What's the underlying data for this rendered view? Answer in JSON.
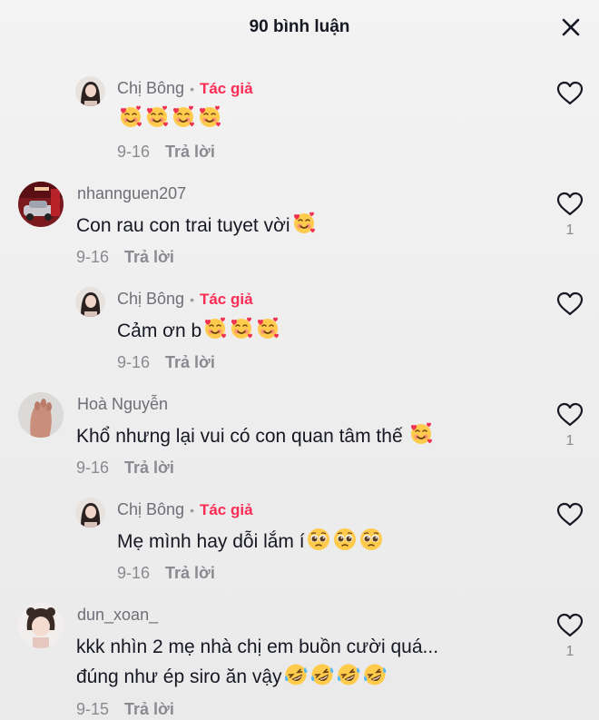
{
  "header": {
    "title": "90 bình luận"
  },
  "comments": [
    {
      "user": "Chị Bông",
      "badge": "Tác giả",
      "text": "",
      "emojis": 4,
      "emoji_type": "smiling-hearts",
      "date": "9-16",
      "reply": "Trả lời",
      "likes": ""
    },
    {
      "user": "nhannguen207",
      "badge": "",
      "text": "Con rau con trai tuyet vời",
      "emojis": 1,
      "emoji_type": "smiling-hearts",
      "date": "9-16",
      "reply": "Trả lời",
      "likes": "1"
    },
    {
      "user": "Chị Bông",
      "badge": "Tác giả",
      "text": "Cảm ơn b",
      "emojis": 3,
      "emoji_type": "smiling-hearts",
      "date": "9-16",
      "reply": "Trả lời",
      "likes": ""
    },
    {
      "user": "Hoà Nguyễn",
      "badge": "",
      "text": "Khổ nhưng lại vui có con quan tâm thế ",
      "emojis": 1,
      "emoji_type": "smiling-hearts",
      "date": "9-16",
      "reply": "Trả lời",
      "likes": "1"
    },
    {
      "user": "Chị Bông",
      "badge": "Tác giả",
      "text": "Mẹ mình hay dỗi lắm í",
      "emojis": 3,
      "emoji_type": "pleading",
      "date": "9-16",
      "reply": "Trả lời",
      "likes": ""
    },
    {
      "user": "dun_xoan_",
      "badge": "",
      "text": "kkk nhìn 2 mẹ nhà chị em buồn cười quá...",
      "text2": "đúng như ép siro ăn vậy",
      "emojis": 4,
      "emoji_type": "rofl",
      "date": "9-15",
      "reply": "Trả lời",
      "likes": "1"
    }
  ],
  "separator": "•"
}
